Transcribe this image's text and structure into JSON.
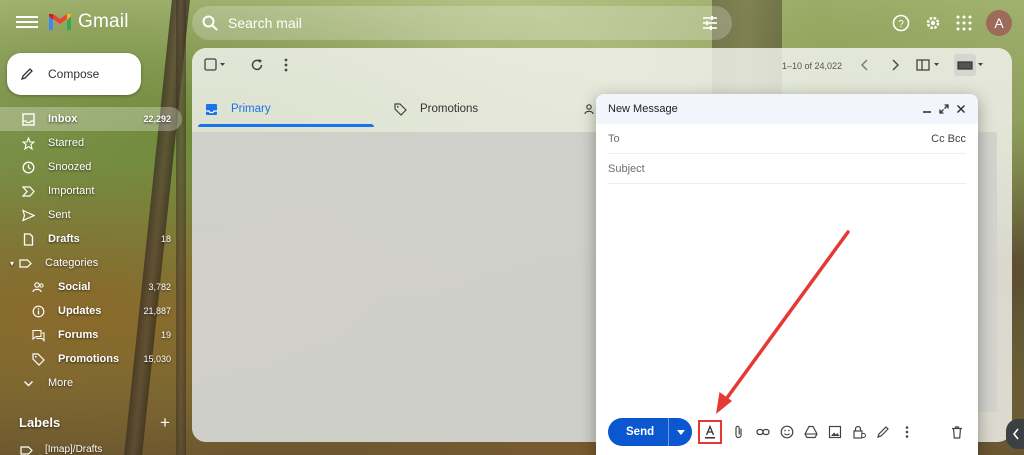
{
  "app": {
    "title": "Gmail",
    "avatar_letter": "A"
  },
  "search": {
    "placeholder": "Search mail"
  },
  "compose_button": {
    "label": "Compose"
  },
  "sidebar": {
    "items": [
      {
        "label": "Inbox",
        "count": "22,292",
        "icon": "inbox-icon"
      },
      {
        "label": "Starred",
        "count": "",
        "icon": "star-icon"
      },
      {
        "label": "Snoozed",
        "count": "",
        "icon": "clock-icon"
      },
      {
        "label": "Important",
        "count": "",
        "icon": "important-icon"
      },
      {
        "label": "Sent",
        "count": "",
        "icon": "send-icon"
      },
      {
        "label": "Drafts",
        "count": "18",
        "icon": "draft-icon"
      },
      {
        "label": "Categories",
        "count": "",
        "icon": "label-icon"
      },
      {
        "label": "Social",
        "count": "3,782",
        "icon": "people-icon"
      },
      {
        "label": "Updates",
        "count": "21,887",
        "icon": "info-icon"
      },
      {
        "label": "Forums",
        "count": "19",
        "icon": "forum-icon"
      },
      {
        "label": "Promotions",
        "count": "15,030",
        "icon": "tag-icon"
      },
      {
        "label": "More",
        "count": "",
        "icon": "chevron-down-icon"
      }
    ],
    "labels_heading": "Labels",
    "labels_item": "[Imap]/Drafts"
  },
  "toolbar": {
    "pager": "1–10 of 24,022"
  },
  "tabs": [
    {
      "label": "Primary"
    },
    {
      "label": "Promotions"
    }
  ],
  "compose_window": {
    "title": "New Message",
    "to_label": "To",
    "cc_bcc": "Cc Bcc",
    "subject_placeholder": "Subject",
    "send_label": "Send"
  },
  "colors": {
    "accent": "#1a73e8",
    "send": "#0b57d0",
    "highlight": "#e53935"
  }
}
